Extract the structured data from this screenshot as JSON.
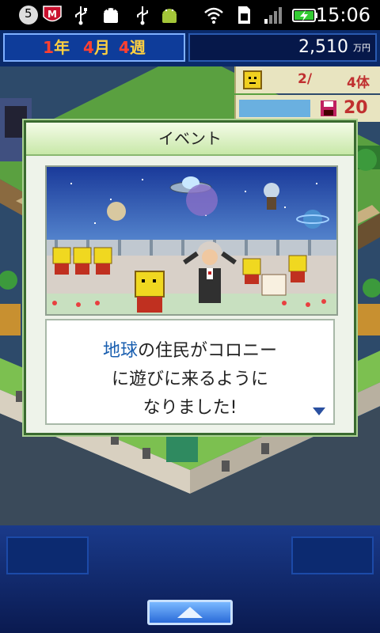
{
  "status_bar": {
    "notification_count": "5",
    "time": "15:06",
    "icons": [
      "notification-count-icon",
      "mcafee-icon",
      "usb-icon",
      "android-debug-icon",
      "usb-icon",
      "android-icon",
      "wifi-icon",
      "sim-icon",
      "signal-icon",
      "battery-charging-icon"
    ]
  },
  "hud": {
    "year_num": "1",
    "year_unit": "年",
    "month_num": "4",
    "month_unit": "月",
    "week_num": "4",
    "week_unit": "週",
    "money": "2,510",
    "money_unit": "万円"
  },
  "stats": {
    "residents": "2/",
    "residents_total": "4体",
    "saves": "20"
  },
  "dialog": {
    "title": "イベント",
    "message_highlight": "地球",
    "message_line1_rest": "の住民がコロニー",
    "message_line2": "に遊びに来るように",
    "message_line3": "なりました!"
  },
  "colors": {
    "highlight": "#1a5fb0",
    "date_red": "#ff4030",
    "date_yellow": "#ffd040",
    "dialog_green": "#3a6a30"
  }
}
